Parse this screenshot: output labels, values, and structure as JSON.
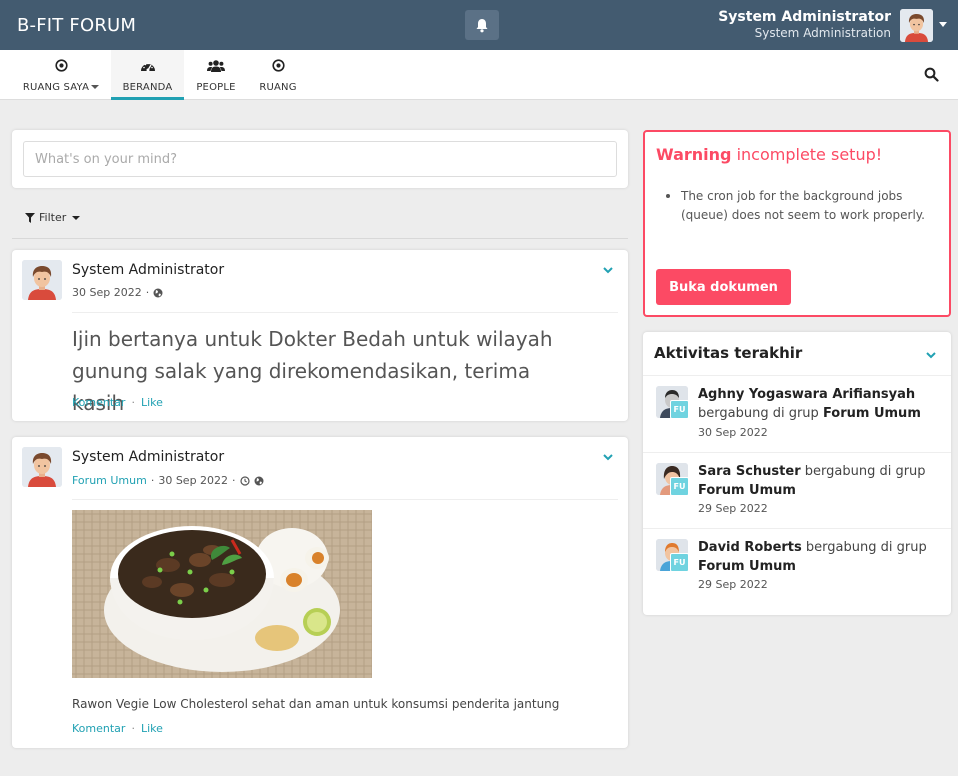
{
  "topbar": {
    "brand": "B-FIT FORUM",
    "user_name": "System Administrator",
    "user_subtitle": "System Administration",
    "bg_color": "#435b70"
  },
  "nav": {
    "items": [
      {
        "label": "RUANG SAYA",
        "icon": "target-icon"
      },
      {
        "label": "BERANDA",
        "icon": "dashboard-icon"
      },
      {
        "label": "PEOPLE",
        "icon": "users-icon"
      },
      {
        "label": "RUANG",
        "icon": "target-icon"
      }
    ],
    "active": "BERANDA",
    "accent": "#21a1b3"
  },
  "composer": {
    "placeholder": "What's on your mind?"
  },
  "filter": {
    "label": "Filter"
  },
  "posts": [
    {
      "author": "System Administrator",
      "date": "30 Sep 2022",
      "visibility_icon": "globe-icon",
      "text": "Ijin bertanya untuk Dokter Bedah untuk wilayah gunung salak yang direkomendasikan, terima kasih",
      "comment_label": "Komentar",
      "like_label": "Like"
    },
    {
      "author": "System Administrator",
      "space": "Forum Umum",
      "date": "30 Sep 2022",
      "visibility_icon": "globe-icon",
      "caption": "Rawon Vegie Low Cholesterol sehat dan aman untuk konsumsi penderita jantung",
      "comment_label": "Komentar",
      "like_label": "Like"
    }
  ],
  "warning": {
    "title_bold": "Warning",
    "title_rest": "incomplete setup!",
    "items": [
      "The cron job for the background jobs (queue) does not seem to work properly."
    ],
    "button": "Buka dokumen",
    "color": "#fc4a64"
  },
  "activity": {
    "title": "Aktivitas terakhir",
    "items": [
      {
        "user": "Aghny Yogaswara Arifiansyah",
        "action": "bergabung di grup",
        "space": "Forum Umum",
        "date": "30 Sep 2022",
        "badge": "FU"
      },
      {
        "user": "Sara Schuster",
        "action": "bergabung di grup",
        "space": "Forum Umum",
        "date": "29 Sep 2022",
        "badge": "FU"
      },
      {
        "user": "David Roberts",
        "action": "bergabung di grup",
        "space": "Forum Umum",
        "date": "29 Sep 2022",
        "badge": "FU"
      }
    ]
  }
}
